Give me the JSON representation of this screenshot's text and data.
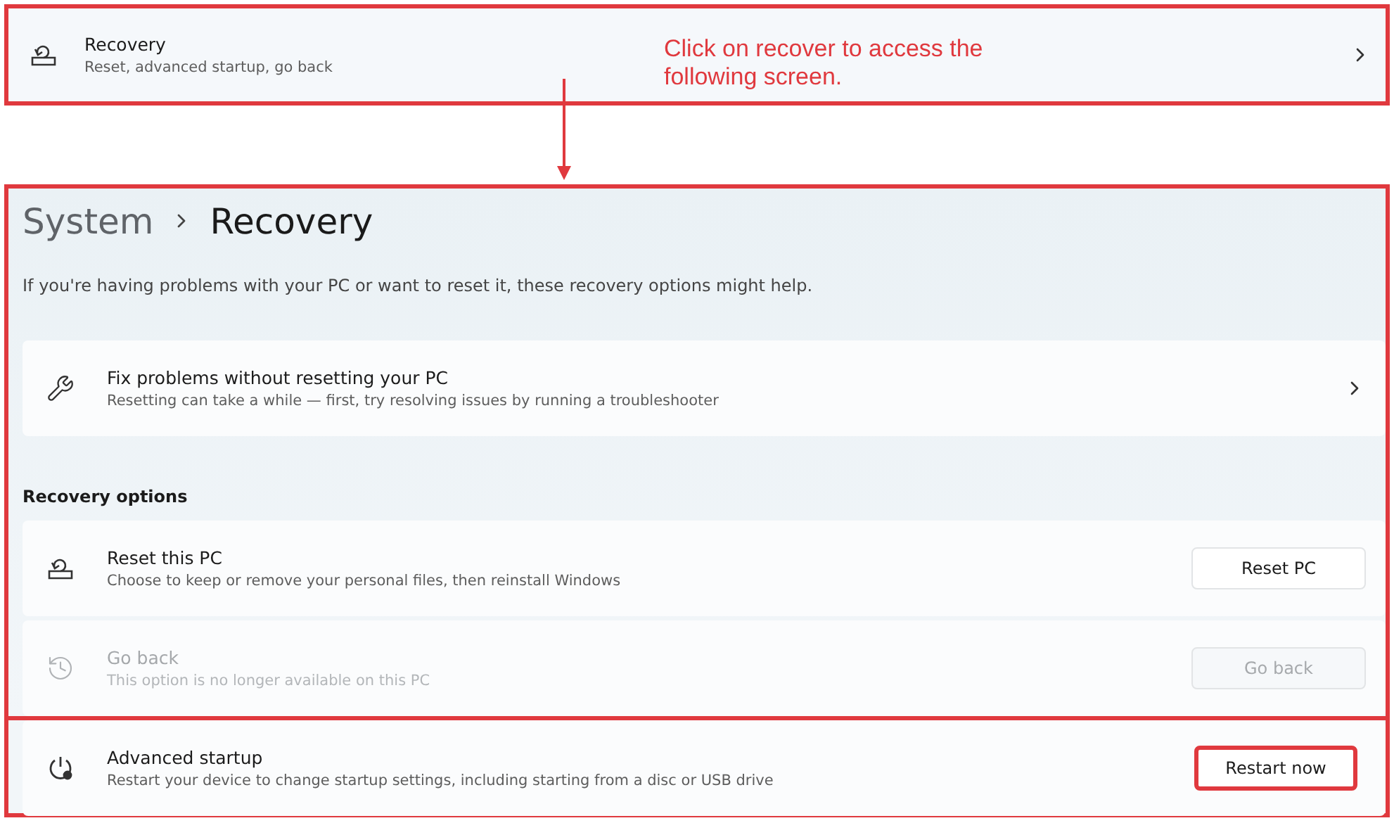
{
  "top_item": {
    "kind": "reset",
    "title": "Recovery",
    "subtitle": "Reset, advanced startup, go back"
  },
  "annotation": "Click on recover to access the following screen.",
  "breadcrumb": {
    "parent": "System",
    "current": "Recovery"
  },
  "description": "If you're having problems with your PC or want to reset it, these recovery options might help.",
  "fix_card": {
    "kind": "wrench",
    "title": "Fix problems without resetting your PC",
    "subtitle": "Resetting can take a while — first, try resolving issues by running a troubleshooter"
  },
  "section_label": "Recovery options",
  "options": [
    {
      "kind": "reset",
      "title": "Reset this PC",
      "subtitle": "Choose to keep or remove your personal files, then reinstall Windows",
      "button": "Reset PC",
      "disabled": false,
      "highlighted": false
    },
    {
      "kind": "history",
      "title": "Go back",
      "subtitle": "This option is no longer available on this PC",
      "button": "Go back",
      "disabled": true,
      "highlighted": false
    }
  ],
  "advanced": {
    "kind": "power",
    "title": "Advanced startup",
    "subtitle": "Restart your device to change startup settings, including starting from a disc or USB drive",
    "button": "Restart now",
    "disabled": false,
    "highlighted": true
  }
}
